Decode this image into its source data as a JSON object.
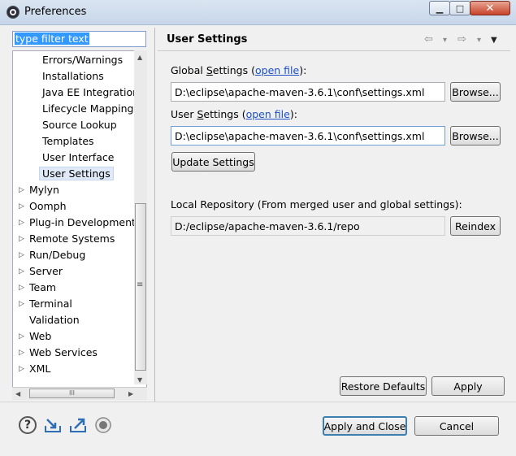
{
  "window": {
    "title": "Preferences",
    "minimize_glyph": "▁",
    "maximize_glyph": "□",
    "close_glyph": "✕"
  },
  "filter": {
    "value": "type filter text"
  },
  "tree": {
    "children": [
      "Errors/Warnings",
      "Installations",
      "Java EE Integration",
      "Lifecycle Mappings",
      "Source Lookup",
      "Templates",
      "User Interface",
      "User Settings"
    ],
    "roots": [
      "Mylyn",
      "Oomph",
      "Plug-in Development",
      "Remote Systems",
      "Run/Debug",
      "Server",
      "Team",
      "Terminal",
      "Validation",
      "Web",
      "Web Services",
      "XML"
    ],
    "expander": "▷"
  },
  "scrollbar": {
    "up": "▲",
    "down": "▼",
    "left": "◀",
    "right": "▶",
    "grip_v": "≡",
    "grip_h": "III"
  },
  "page": {
    "title": "User Settings",
    "nav_back": "⇦",
    "nav_forward": "⇨",
    "nav_dropdown": "▾",
    "menu": "▼",
    "global_label_a": "Global ",
    "global_label_u": "S",
    "global_label_b": "ettings (",
    "global_link": "open file",
    "global_label_c": "):",
    "global_path": "D:\\eclipse\\apache-maven-3.6.1\\conf\\settings.xml",
    "user_label_a": "User ",
    "user_label_u": "S",
    "user_label_b": "ettings (",
    "user_link": "open file",
    "user_label_c": "):",
    "user_path": "D:\\eclipse\\apache-maven-3.6.1\\conf\\settings.xml",
    "browse": "Browse...",
    "update_settings": "Update Settings",
    "local_repo_label": "Local Repository (From merged user and global settings):",
    "local_repo_path": "D:/eclipse/apache-maven-3.6.1/repo",
    "reindex": "Reindex",
    "restore_defaults": "Restore Defaults",
    "apply": "Apply"
  },
  "footer": {
    "apply_close": "Apply and Close",
    "cancel": "Cancel",
    "help_glyph": "?"
  }
}
